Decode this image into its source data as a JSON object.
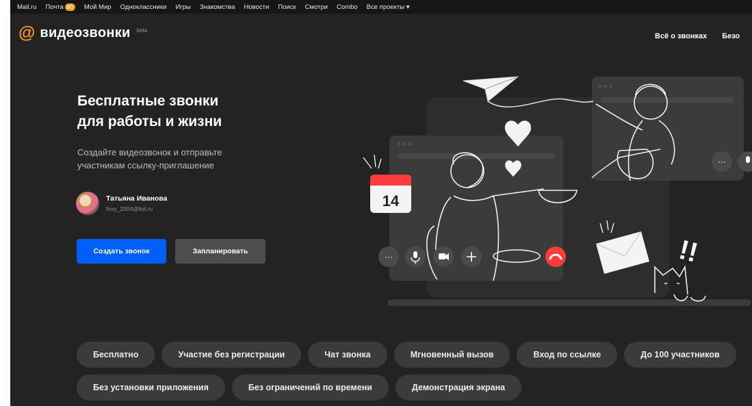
{
  "portal": {
    "items": [
      "Mail.ru",
      "Почта",
      "Мой Мир",
      "Одноклассники",
      "Игры",
      "Знакомства",
      "Новости",
      "Поиск",
      "Смотри",
      "Combo",
      "Все проекты ▾"
    ],
    "mail_badge": "80"
  },
  "header": {
    "logo_symbol": "@",
    "logo_text": "видеозвонки",
    "logo_beta": "beta",
    "nav": [
      "Всё о звонках",
      "Безо"
    ]
  },
  "hero": {
    "title_line1": "Бесплатные звонки",
    "title_line2": "для работы и жизни",
    "subtitle_line1": "Создайте видеозвонок и отправьте",
    "subtitle_line2": "участникам ссылку-приглашение"
  },
  "user": {
    "name": "Татьяна Иванова",
    "email": "foxy_2004@list.ru"
  },
  "buttons": {
    "create_call": "Создать звонок",
    "schedule": "Запланировать"
  },
  "illustration": {
    "calendar_day": "14",
    "call_icons": [
      "more-icon",
      "microphone-icon",
      "camera-icon",
      "plus-icon",
      "hangup-icon"
    ]
  },
  "features": {
    "row1": [
      "Бесплатно",
      "Участие без регистрации",
      "Чат звонка",
      "Мгновенный вызов",
      "Вход по ссылке",
      "До 100 участников"
    ],
    "row2": [
      "Без установки приложения",
      "Без ограничений по времени",
      "Демонстрация экрана"
    ]
  },
  "colors": {
    "background": "#232323",
    "accent_logo": "#f59a23",
    "primary_button": "#005ff9",
    "secondary_button": "#4d4d4d",
    "chip": "#3b3b3b",
    "hangup": "#ff3b3b",
    "calendar_red": "#ff3b3b"
  }
}
